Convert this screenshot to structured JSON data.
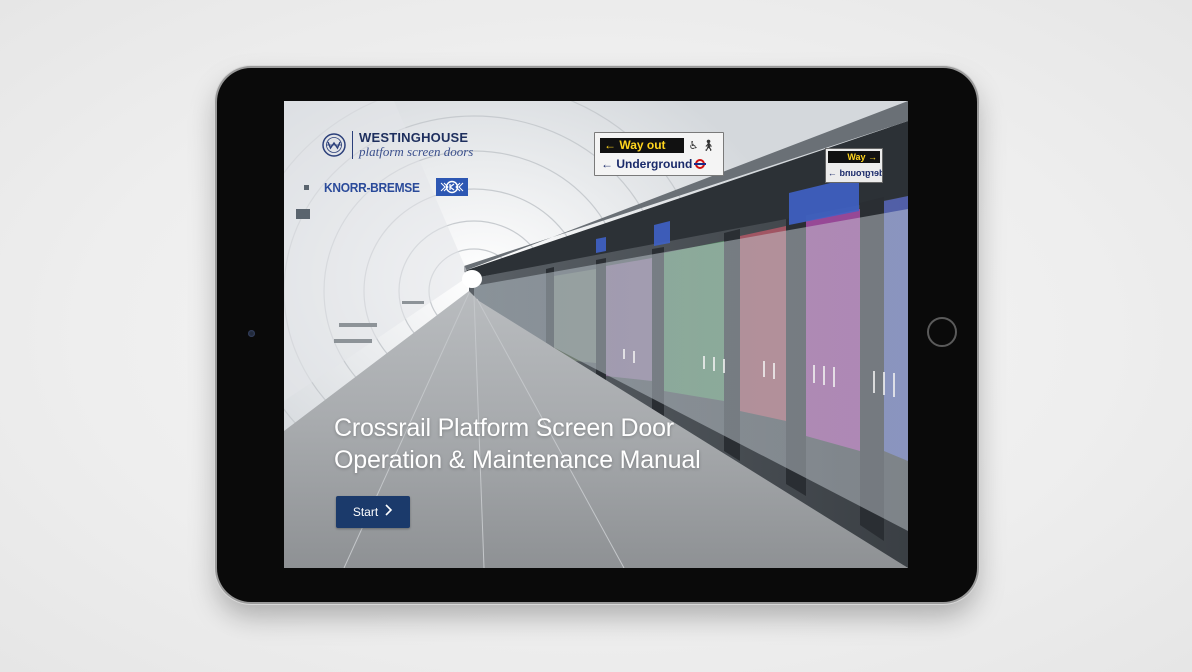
{
  "device": {
    "type": "tablet"
  },
  "branding": {
    "westinghouse_name": "WESTINGHOUSE",
    "westinghouse_tagline": "platform screen doors",
    "knorr_name": "KNORR-BREMSE"
  },
  "signage": {
    "way_out": "← Way out",
    "underground": "← Underground",
    "back_sign_top": "Way →",
    "back_sign_bottom": "Underground →"
  },
  "hero": {
    "title_line1": "Crossrail Platform Screen Door",
    "title_line2": "Operation & Maintenance Manual"
  },
  "actions": {
    "start_label": "Start",
    "start_icon": "chevron-right-icon"
  },
  "colors": {
    "button_bg": "#1b3a6b",
    "brand_navy": "#1e2f5e",
    "knorr_blue": "#2d57b3"
  }
}
